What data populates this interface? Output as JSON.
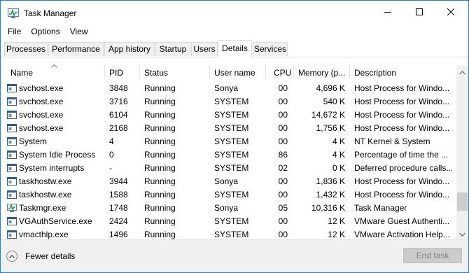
{
  "window": {
    "title": "Task Manager",
    "controls": {
      "minimize_icon": "minimize-icon",
      "maximize_icon": "maximize-icon",
      "close_icon": "close-icon"
    }
  },
  "menu": [
    "File",
    "Options",
    "View"
  ],
  "tabs": [
    {
      "label": "Processes",
      "active": false
    },
    {
      "label": "Performance",
      "active": false
    },
    {
      "label": "App history",
      "active": false
    },
    {
      "label": "Startup",
      "active": false
    },
    {
      "label": "Users",
      "active": false
    },
    {
      "label": "Details",
      "active": true
    },
    {
      "label": "Services",
      "active": false
    }
  ],
  "table": {
    "columns": [
      "Name",
      "PID",
      "Status",
      "User name",
      "CPU",
      "Memory (p...",
      "Description"
    ],
    "sorted_column": "Name",
    "rows": [
      {
        "icon": "service-window-icon",
        "name": "svchost.exe",
        "pid": "3848",
        "status": "Running",
        "user": "Sonya",
        "cpu": "00",
        "memory": "4,696 K",
        "description": "Host Process for Windo..."
      },
      {
        "icon": "service-window-icon",
        "name": "svchost.exe",
        "pid": "3716",
        "status": "Running",
        "user": "SYSTEM",
        "cpu": "00",
        "memory": "540 K",
        "description": "Host Process for Windo..."
      },
      {
        "icon": "service-window-icon",
        "name": "svchost.exe",
        "pid": "6104",
        "status": "Running",
        "user": "SYSTEM",
        "cpu": "00",
        "memory": "14,672 K",
        "description": "Host Process for Windo..."
      },
      {
        "icon": "service-window-icon",
        "name": "svchost.exe",
        "pid": "2168",
        "status": "Running",
        "user": "SYSTEM",
        "cpu": "00",
        "memory": "1,756 K",
        "description": "Host Process for Windo..."
      },
      {
        "icon": "service-window-icon",
        "name": "System",
        "pid": "4",
        "status": "Running",
        "user": "SYSTEM",
        "cpu": "00",
        "memory": "4 K",
        "description": "NT Kernel & System"
      },
      {
        "icon": "service-window-icon",
        "name": "System Idle Process",
        "pid": "0",
        "status": "Running",
        "user": "SYSTEM",
        "cpu": "86",
        "memory": "4 K",
        "description": "Percentage of time the ..."
      },
      {
        "icon": "service-window-icon",
        "name": "System interrupts",
        "pid": "-",
        "status": "Running",
        "user": "SYSTEM",
        "cpu": "02",
        "memory": "0 K",
        "description": "Deferred procedure calls..."
      },
      {
        "icon": "service-window-icon",
        "name": "taskhostw.exe",
        "pid": "3944",
        "status": "Running",
        "user": "Sonya",
        "cpu": "00",
        "memory": "1,836 K",
        "description": "Host Process for Windo..."
      },
      {
        "icon": "service-window-icon",
        "name": "taskhostw.exe",
        "pid": "1588",
        "status": "Running",
        "user": "SYSTEM",
        "cpu": "00",
        "memory": "1,432 K",
        "description": "Host Process for Windo..."
      },
      {
        "icon": "task-manager-icon",
        "name": "Taskmgr.exe",
        "pid": "1748",
        "status": "Running",
        "user": "Sonya",
        "cpu": "05",
        "memory": "10,316 K",
        "description": "Task Manager"
      },
      {
        "icon": "service-window-icon",
        "name": "VGAuthService.exe",
        "pid": "2424",
        "status": "Running",
        "user": "SYSTEM",
        "cpu": "00",
        "memory": "12 K",
        "description": "VMware Guest Authenti..."
      },
      {
        "icon": "service-window-icon",
        "name": "vmacthlp.exe",
        "pid": "1496",
        "status": "Running",
        "user": "SYSTEM",
        "cpu": "00",
        "memory": "12 K",
        "description": "VMware Activation Help..."
      }
    ]
  },
  "footer": {
    "fewer_details": "Fewer details",
    "end_task": "End task",
    "end_task_enabled": false
  },
  "colors": {
    "window_border": "#1883d7",
    "footer_bg": "#f0f0f0",
    "disabled_text": "#838383"
  }
}
